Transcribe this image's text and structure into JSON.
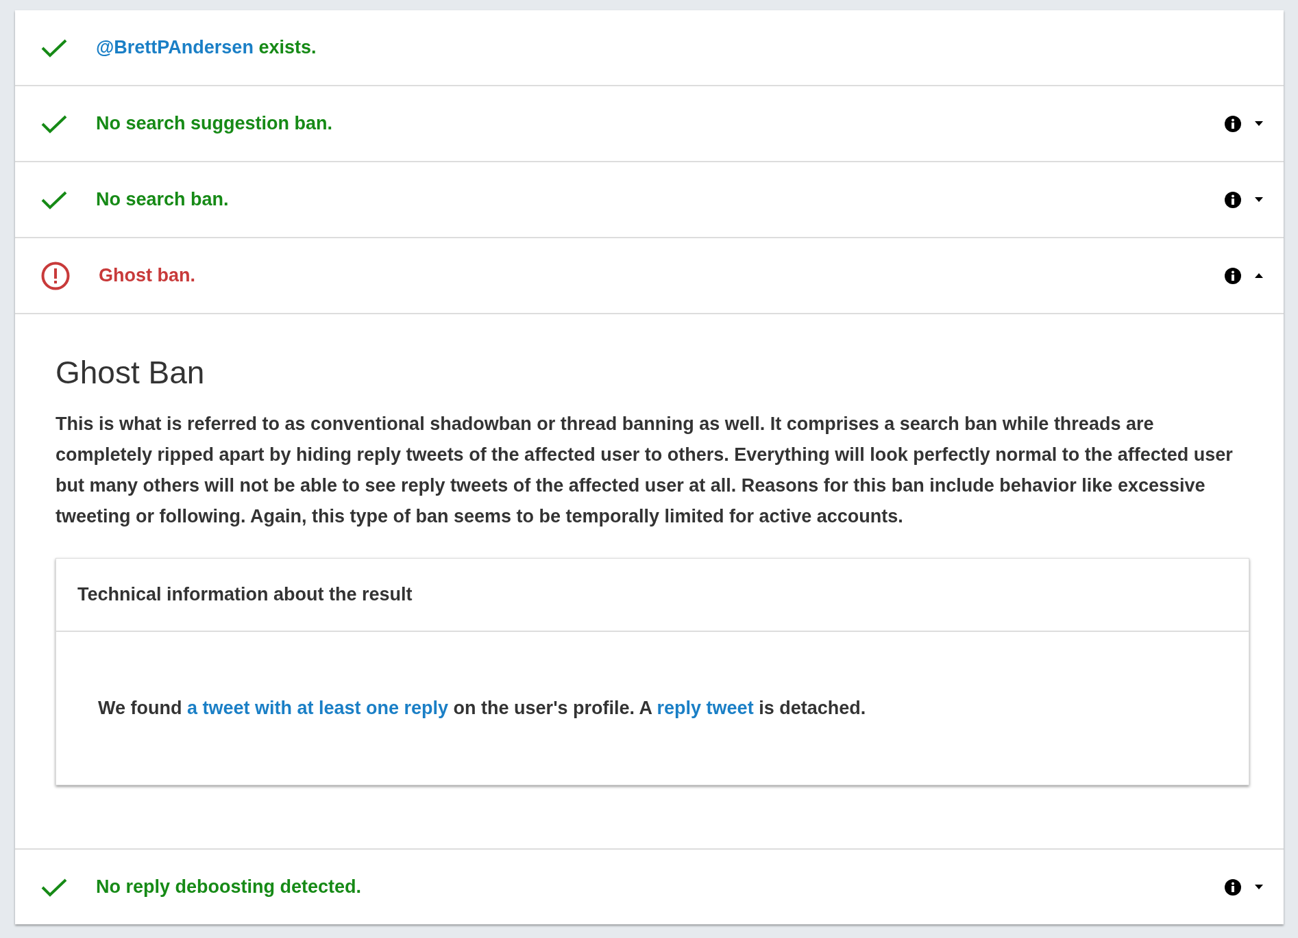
{
  "results": [
    {
      "kind": "ok",
      "parts": [
        {
          "text": "@BrettPAndersen",
          "link": true
        },
        {
          "text": " exists.",
          "link": false
        }
      ]
    },
    {
      "kind": "ok",
      "parts": [
        {
          "text": "No search suggestion ban.",
          "link": false
        }
      ],
      "expanded": false
    },
    {
      "kind": "ok",
      "parts": [
        {
          "text": "No search ban.",
          "link": false
        }
      ],
      "expanded": false
    },
    {
      "kind": "ban",
      "parts": [
        {
          "text": "Ghost ban.",
          "link": false
        }
      ],
      "expanded": true,
      "detail": {
        "title": "Ghost Ban",
        "text": "This is what is referred to as conventional shadowban or thread banning as well. It comprises a search ban while threads are completely ripped apart by hiding reply tweets of the affected user to others. Everything will look perfectly normal to the affected user but many others will not be able to see reply tweets of the affected user at all. Reasons for this ban include behavior like excessive tweeting or following. Again, this type of ban seems to be temporally limited for active accounts.",
        "technical": {
          "title": "Technical information about the result",
          "parts": [
            {
              "text": "We found ",
              "link": false
            },
            {
              "text": "a tweet with at least one reply",
              "link": true
            },
            {
              "text": " on the user's profile. A ",
              "link": false
            },
            {
              "text": "reply tweet",
              "link": true
            },
            {
              "text": " is detached.",
              "link": false
            }
          ]
        }
      }
    },
    {
      "kind": "ok",
      "parts": [
        {
          "text": "No reply deboosting detected.",
          "link": false
        }
      ],
      "expanded": false
    }
  ]
}
